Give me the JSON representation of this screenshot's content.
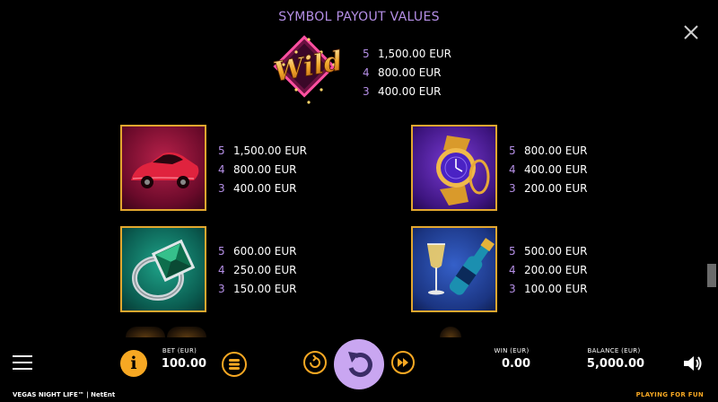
{
  "header": {
    "title": "SYMBOL PAYOUT VALUES"
  },
  "wild": {
    "label": "Wild",
    "payouts": [
      {
        "count": "5",
        "amount": "1,500.00 EUR"
      },
      {
        "count": "4",
        "amount": "800.00 EUR"
      },
      {
        "count": "3",
        "amount": "400.00 EUR"
      }
    ]
  },
  "symbols": [
    {
      "name": "car",
      "payouts": [
        {
          "count": "5",
          "amount": "1,500.00 EUR"
        },
        {
          "count": "4",
          "amount": "800.00 EUR"
        },
        {
          "count": "3",
          "amount": "400.00 EUR"
        }
      ]
    },
    {
      "name": "watch",
      "payouts": [
        {
          "count": "5",
          "amount": "800.00 EUR"
        },
        {
          "count": "4",
          "amount": "400.00 EUR"
        },
        {
          "count": "3",
          "amount": "200.00 EUR"
        }
      ]
    },
    {
      "name": "ring",
      "payouts": [
        {
          "count": "5",
          "amount": "600.00 EUR"
        },
        {
          "count": "4",
          "amount": "250.00 EUR"
        },
        {
          "count": "3",
          "amount": "150.00 EUR"
        }
      ]
    },
    {
      "name": "champagne",
      "payouts": [
        {
          "count": "5",
          "amount": "500.00 EUR"
        },
        {
          "count": "4",
          "amount": "200.00 EUR"
        },
        {
          "count": "3",
          "amount": "100.00 EUR"
        }
      ]
    }
  ],
  "bottom_bar": {
    "bet_label": "BET (EUR)",
    "bet_value": "100.00",
    "win_label": "WIN (EUR)",
    "win_value": "0.00",
    "balance_label": "BALANCE (EUR)",
    "balance_value": "5,000.00",
    "info_glyph": "i"
  },
  "footer": {
    "game_name": "VEGAS NIGHT LIFE™ | NetEnt",
    "mode": "PLAYING FOR FUN"
  },
  "colors": {
    "accent_purple": "#b58fe6",
    "frame_gold": "#e3a72f",
    "info_orange": "#f7a823",
    "spin_lilac": "#c9a6f1"
  },
  "icons": [
    "close-icon",
    "menu-icon",
    "info-icon",
    "coin-stack-icon",
    "autoplay-icon",
    "spin-icon",
    "fast-forward-icon",
    "speaker-icon"
  ]
}
